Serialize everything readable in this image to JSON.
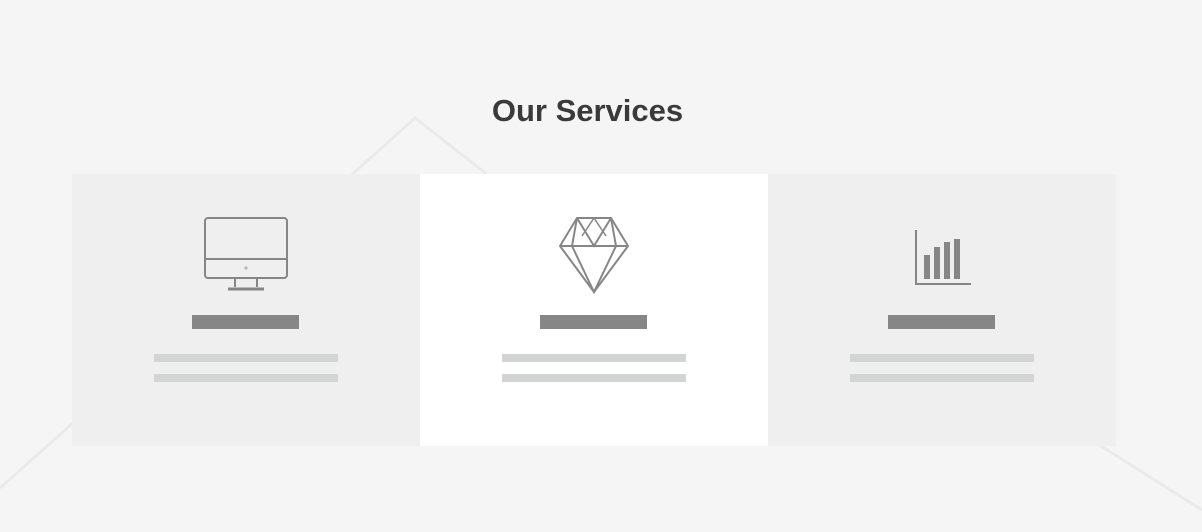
{
  "page": {
    "title": "Our Services"
  },
  "services": [
    {
      "icon": "desktop-monitor-icon",
      "style": "muted"
    },
    {
      "icon": "diamond-icon",
      "style": "highlighted"
    },
    {
      "icon": "bar-chart-icon",
      "style": "muted"
    }
  ],
  "colors": {
    "page_background": "#f5f5f5",
    "card_background": "#efefef",
    "card_highlight_background": "#ffffff",
    "title_text": "#3a3a3a",
    "icon_stroke": "#868686",
    "heading_placeholder": "#868686",
    "text_placeholder": "#d3d5d5"
  }
}
